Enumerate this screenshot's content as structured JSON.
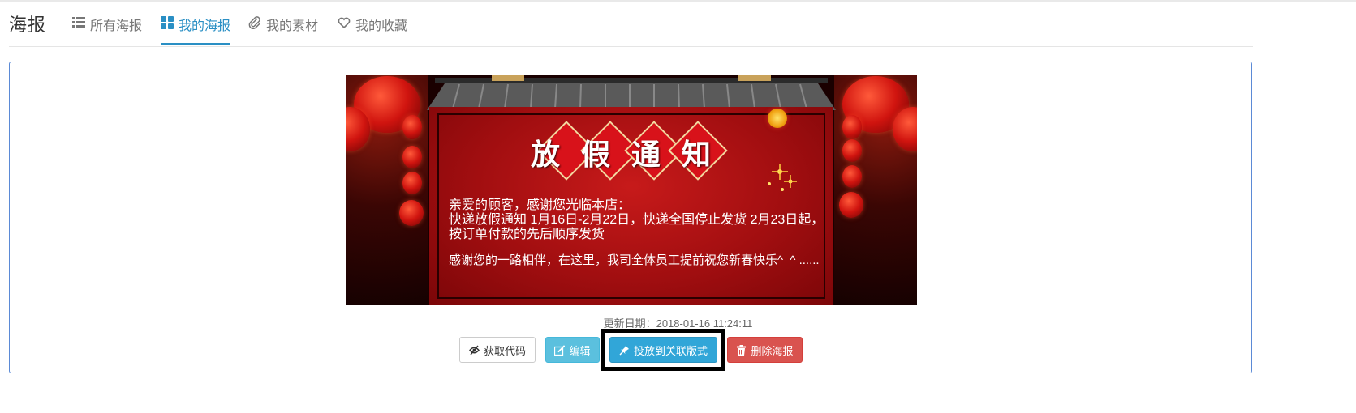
{
  "header": {
    "title": "海报",
    "tabs": [
      {
        "label": "所有海报",
        "icon": "list-icon",
        "active": false
      },
      {
        "label": "我的海报",
        "icon": "grid-icon",
        "active": true
      },
      {
        "label": "我的素材",
        "icon": "paperclip-icon",
        "active": false
      },
      {
        "label": "我的收藏",
        "icon": "heart-icon",
        "active": false
      }
    ]
  },
  "poster": {
    "heading": "放假通知",
    "line1": "亲爱的顾客，感谢您光临本店：",
    "line2": "快递放假通知 1月16日-2月22日，快递全国停止发货 2月23日起，",
    "line3": "按订单付款的先后顺序发货",
    "line4": "感谢您的一路相伴，在这里，我司全体员工提前祝您新春快乐^_^ ......"
  },
  "update_text": "更新日期：2018-01-16 11:24:11",
  "buttons": {
    "get_code": "获取代码",
    "edit": "编辑",
    "place": "投放到关联版式",
    "delete": "删除海报"
  },
  "colors": {
    "accent": "#2a8fc4",
    "panel_border": "#5b8ad6",
    "info": "#5bc0de",
    "primary_info": "#31a6d8",
    "danger": "#d9534f",
    "highlight": "#000000"
  }
}
